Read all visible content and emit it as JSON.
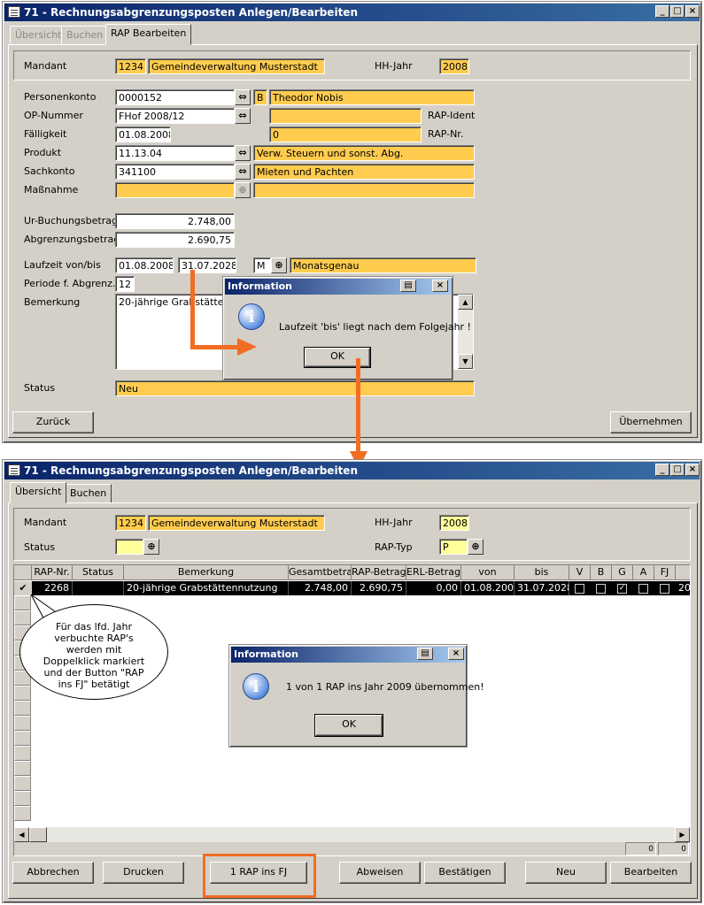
{
  "window1": {
    "title": "71 - Rechnungsabgrenzungsposten Anlegen/Bearbeiten",
    "tabs": [
      "Übersicht",
      "Buchen",
      "RAP Bearbeiten"
    ],
    "mandant_label": "Mandant",
    "mandant_nr": "1234",
    "mandant_name": "Gemeindeverwaltung Musterstadt",
    "hhjahr_label": "HH-Jahr",
    "hhjahr": "2008",
    "personenkonto_label": "Personenkonto",
    "personenkonto": "0000152",
    "pk_flag": "B",
    "pk_name": "Theodor Nobis",
    "opnummer_label": "OP-Nummer",
    "opnummer": "FHof 2008/12",
    "rapident_label": "RAP-Ident",
    "rapident": "",
    "faelligkeit_label": "Fälligkeit",
    "faelligkeit": "01.08.2008",
    "rapnr_label": "RAP-Nr.",
    "rapnr": "0",
    "produkt_label": "Produkt",
    "produkt": "11.13.04",
    "produkt_name": "Verw. Steuern und sonst. Abg.",
    "sachkonto_label": "Sachkonto",
    "sachkonto": "341100",
    "sachkonto_name": "Mieten und Pachten",
    "massnahme_label": "Maßnahme",
    "urbuchung_label": "Ur-Buchungsbetrag",
    "urbuchung": "2.748,00",
    "abgrenzung_label": "Abgrenzungsbetrag",
    "abgrenzung": "2.690,75",
    "laufzeit_label": "Laufzeit von/bis",
    "laufzeit_von": "01.08.2008",
    "laufzeit_bis": "31.07.2028",
    "laufzeit_m": "M",
    "laufzeit_text": "Monatsgenau",
    "periode_label": "Periode f. Abgrenz.",
    "periode": "12",
    "bemerkung_label": "Bemerkung",
    "bemerkung": "20-jährige Grabstättennut",
    "status_label": "Status",
    "status": "Neu",
    "zurueck": "Zurück",
    "uebernehmen": "Übernehmen"
  },
  "dialog1": {
    "title": "Information",
    "message": "Laufzeit 'bis' liegt nach dem Folgejahr !",
    "ok": "OK"
  },
  "window2": {
    "title": "71 - Rechnungsabgrenzungsposten Anlegen/Bearbeiten",
    "tabs": [
      "Übersicht",
      "Buchen"
    ],
    "mandant_label": "Mandant",
    "mandant_nr": "1234",
    "mandant_name": "Gemeindeverwaltung Musterstadt",
    "hhjahr_label": "HH-Jahr",
    "hhjahr": "2008",
    "status_label": "Status",
    "raptyp_label": "RAP-Typ",
    "raptyp": "P",
    "columns": [
      "RAP-Nr.",
      "Status",
      "Bemerkung",
      "Gesamtbetrag",
      "RAP-Betrag",
      "ERL-Betrag",
      "von",
      "bis",
      "V",
      "B",
      "G",
      "A",
      "FJ",
      ""
    ],
    "row": {
      "rapnr": "2268",
      "status": "",
      "bemerkung": "20-jährige Grabstättennutzung",
      "gesamt": "2.748,00",
      "rap": "2.690,75",
      "erl": "0,00",
      "von": "01.08.2008",
      "bis": "31.07.2028",
      "trunc": "20"
    },
    "footer": [
      "0",
      "0"
    ],
    "buttons": {
      "abbrechen": "Abbrechen",
      "drucken": "Drucken",
      "rapinsfj": "1 RAP ins FJ",
      "abweisen": "Abweisen",
      "bestaetigen": "Bestätigen",
      "neu": "Neu",
      "bearbeiten": "Bearbeiten"
    },
    "callout": "Für das lfd. Jahr verbuchte RAP's werden mit Doppelklick markiert und der Button \"RAP ins FJ\" betätigt"
  },
  "dialog2": {
    "title": "Information",
    "message": "1 von 1 RAP ins Jahr 2009 übernommen!",
    "ok": "OK"
  },
  "colors": {
    "accent": "#f26d21",
    "highlight": "#ffcc4f",
    "title": "#0a246a"
  }
}
